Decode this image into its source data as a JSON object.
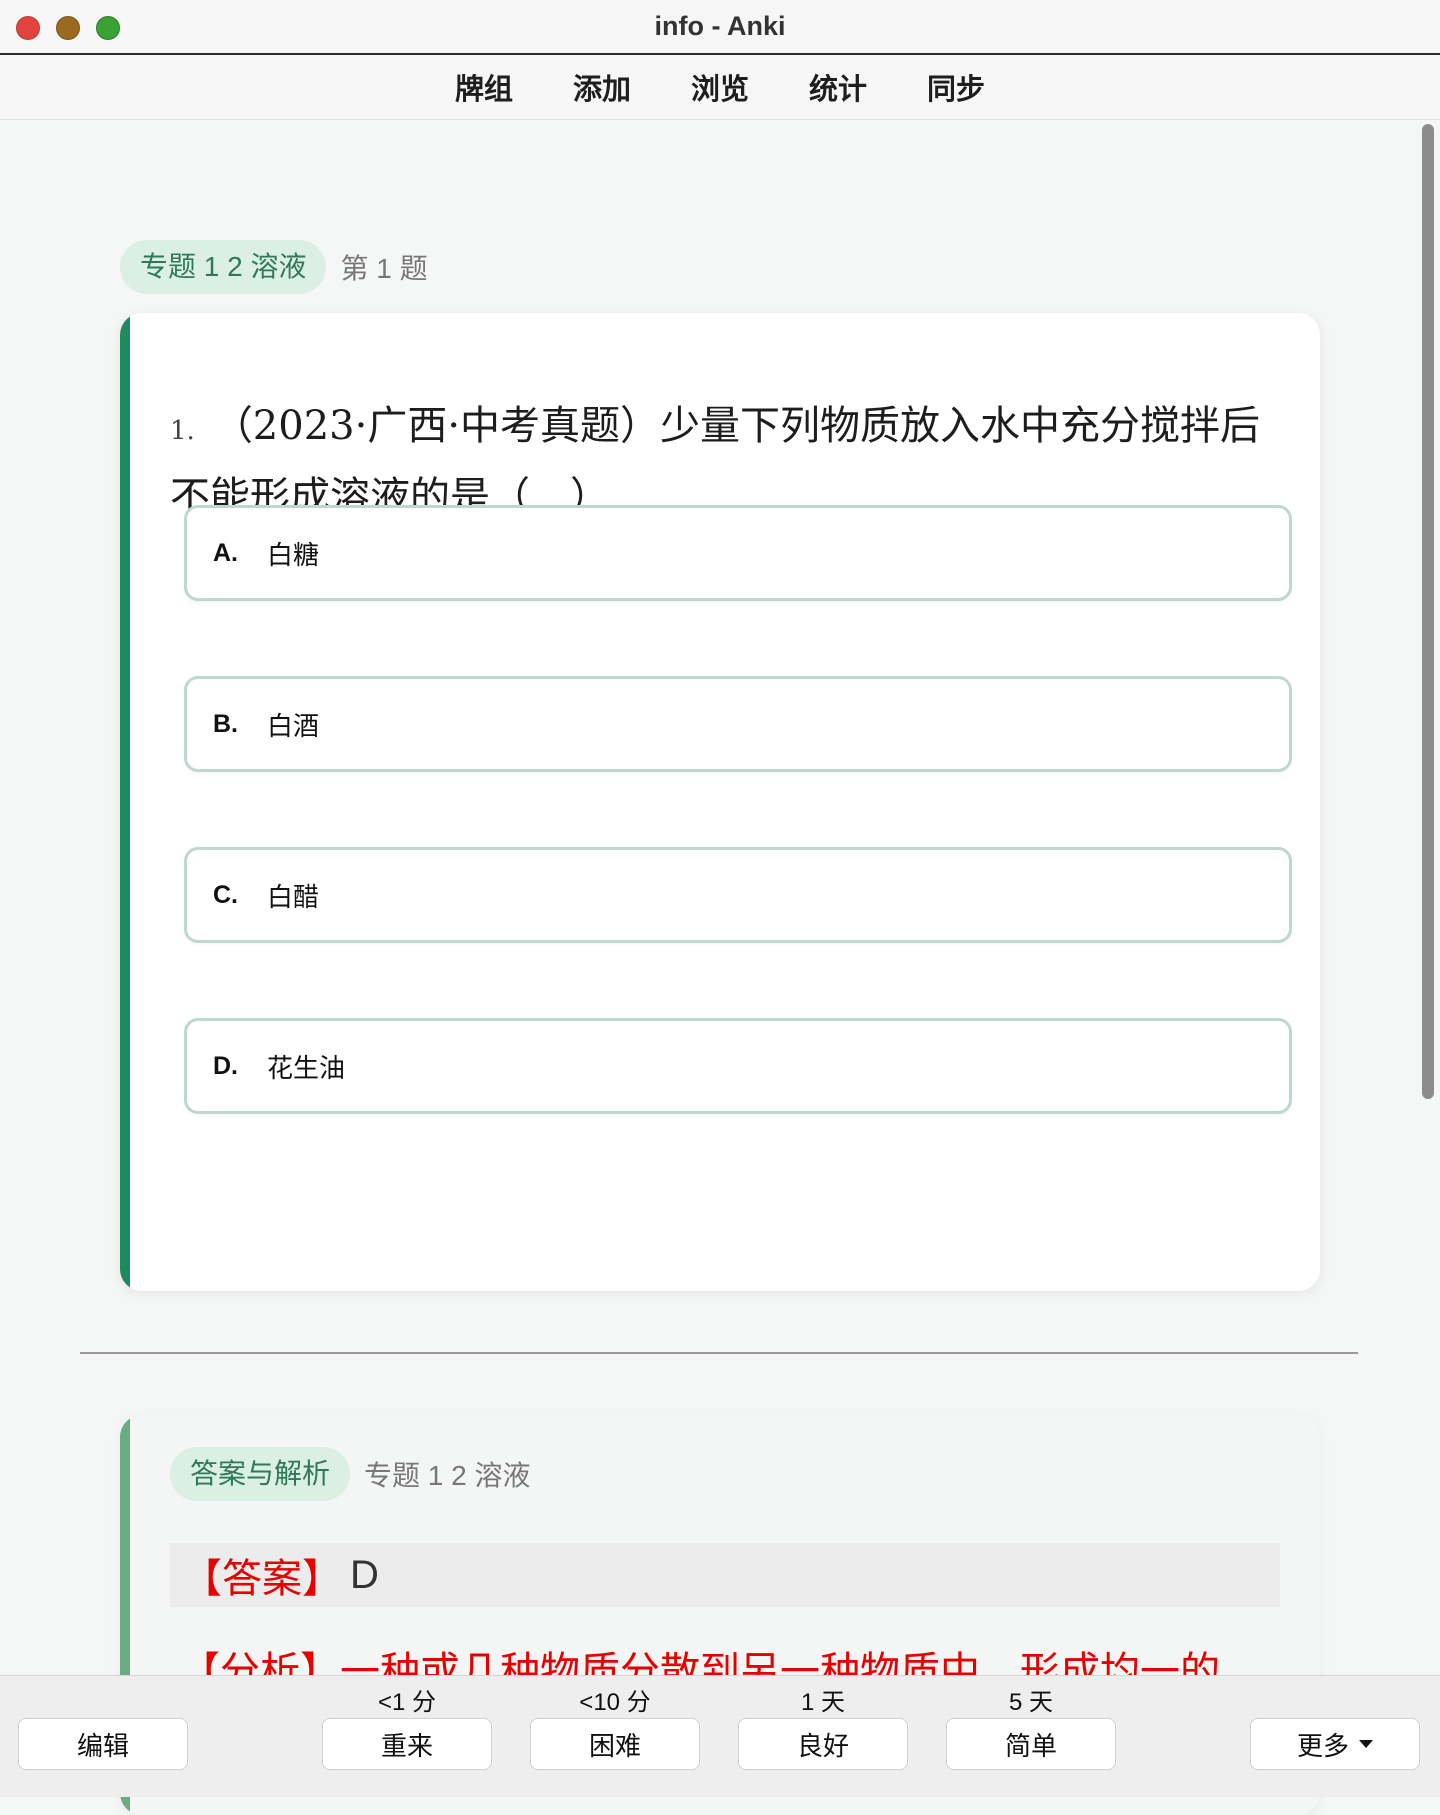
{
  "window": {
    "title": "info - Anki"
  },
  "menu": {
    "items": [
      "牌组",
      "添加",
      "浏览",
      "统计",
      "同步"
    ]
  },
  "question": {
    "topic_tag": "专题 1 2 溶液",
    "question_index_label": "第 1 题",
    "number": "1.",
    "text": "（2023·广西·中考真题）少量下列物质放入水中充分搅拌后不能形成溶液的是（　）",
    "options": [
      {
        "letter": "A.",
        "text": "白糖"
      },
      {
        "letter": "B.",
        "text": "白酒"
      },
      {
        "letter": "C.",
        "text": "白醋"
      },
      {
        "letter": "D.",
        "text": "花生油"
      }
    ]
  },
  "answer": {
    "tag": "答案与解析",
    "topic": "专题 1 2 溶液",
    "answer_label": "【答案】",
    "answer_value": "D",
    "analysis_partial": "【分析】一种或几种物质分散到另一种物质中，形成均一的"
  },
  "bottom_bar": {
    "edit_label": "编辑",
    "more_label": "更多",
    "ease_buttons": [
      {
        "interval": "<1 分",
        "label": "重来"
      },
      {
        "interval": "<10 分",
        "label": "困难"
      },
      {
        "interval": "1 天",
        "label": "良好"
      },
      {
        "interval": "5 天",
        "label": "简单"
      }
    ]
  }
}
